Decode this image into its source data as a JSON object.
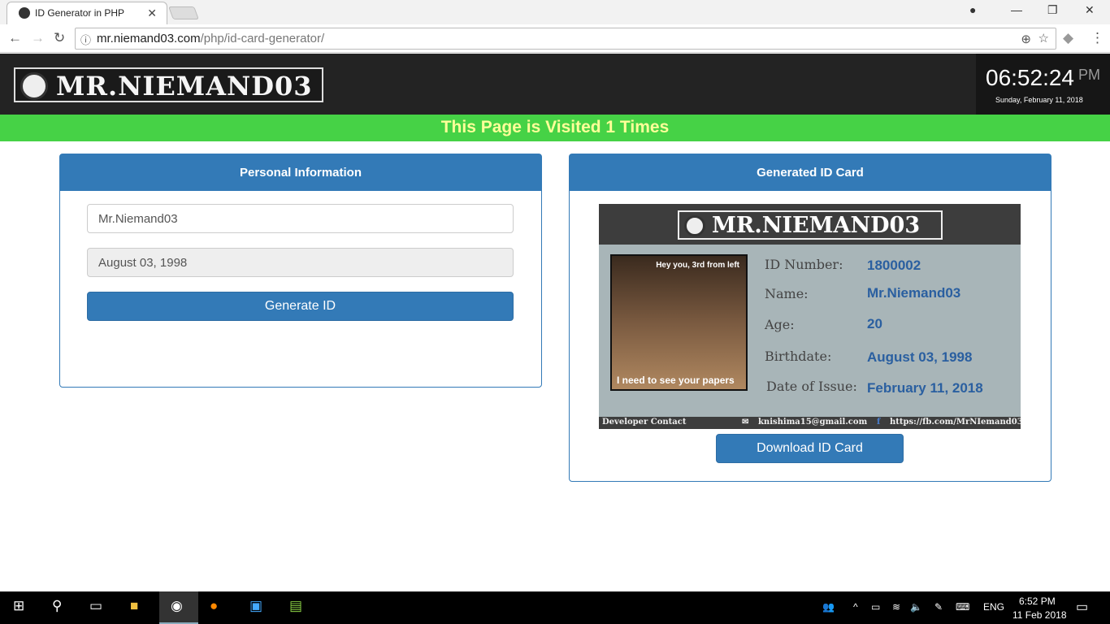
{
  "browser": {
    "tab_title": "ID Generator in PHP",
    "url_host": "mr.niemand03.com",
    "url_path": "/php/id-card-generator/"
  },
  "header": {
    "logo_text": "MR.NIEMAND03",
    "time": "06:52:24",
    "ampm": "PM",
    "date": "Sunday, February 11, 2018"
  },
  "visit_banner": "This Page is Visited 1 Times",
  "personal": {
    "title": "Personal Information",
    "name_value": "Mr.Niemand03",
    "birthdate_value": "August 03, 1998",
    "generate_label": "Generate ID"
  },
  "generated": {
    "title": "Generated ID Card",
    "download_label": "Download ID Card",
    "card": {
      "logo_text": "MR.NIEMAND03",
      "photo_caption_top": "Hey you, 3rd from left",
      "photo_caption_bottom": "I need to see  your papers",
      "fields": [
        {
          "label": "ID Number:",
          "value": "1800002"
        },
        {
          "label": "Name:",
          "value": "Mr.Niemand03"
        },
        {
          "label": "Age:",
          "value": "20"
        },
        {
          "label": "Birthdate:",
          "value": "August 03, 1998"
        },
        {
          "label": "Date of Issue:",
          "value": "February 11, 2018"
        }
      ],
      "footer_label": "Developer Contact",
      "email": "knishima15@gmail.com",
      "facebook": "https://fb.com/MrNIemand03"
    }
  },
  "taskbar": {
    "lang": "ENG",
    "time": "6:52 PM",
    "date": "11 Feb 2018"
  }
}
